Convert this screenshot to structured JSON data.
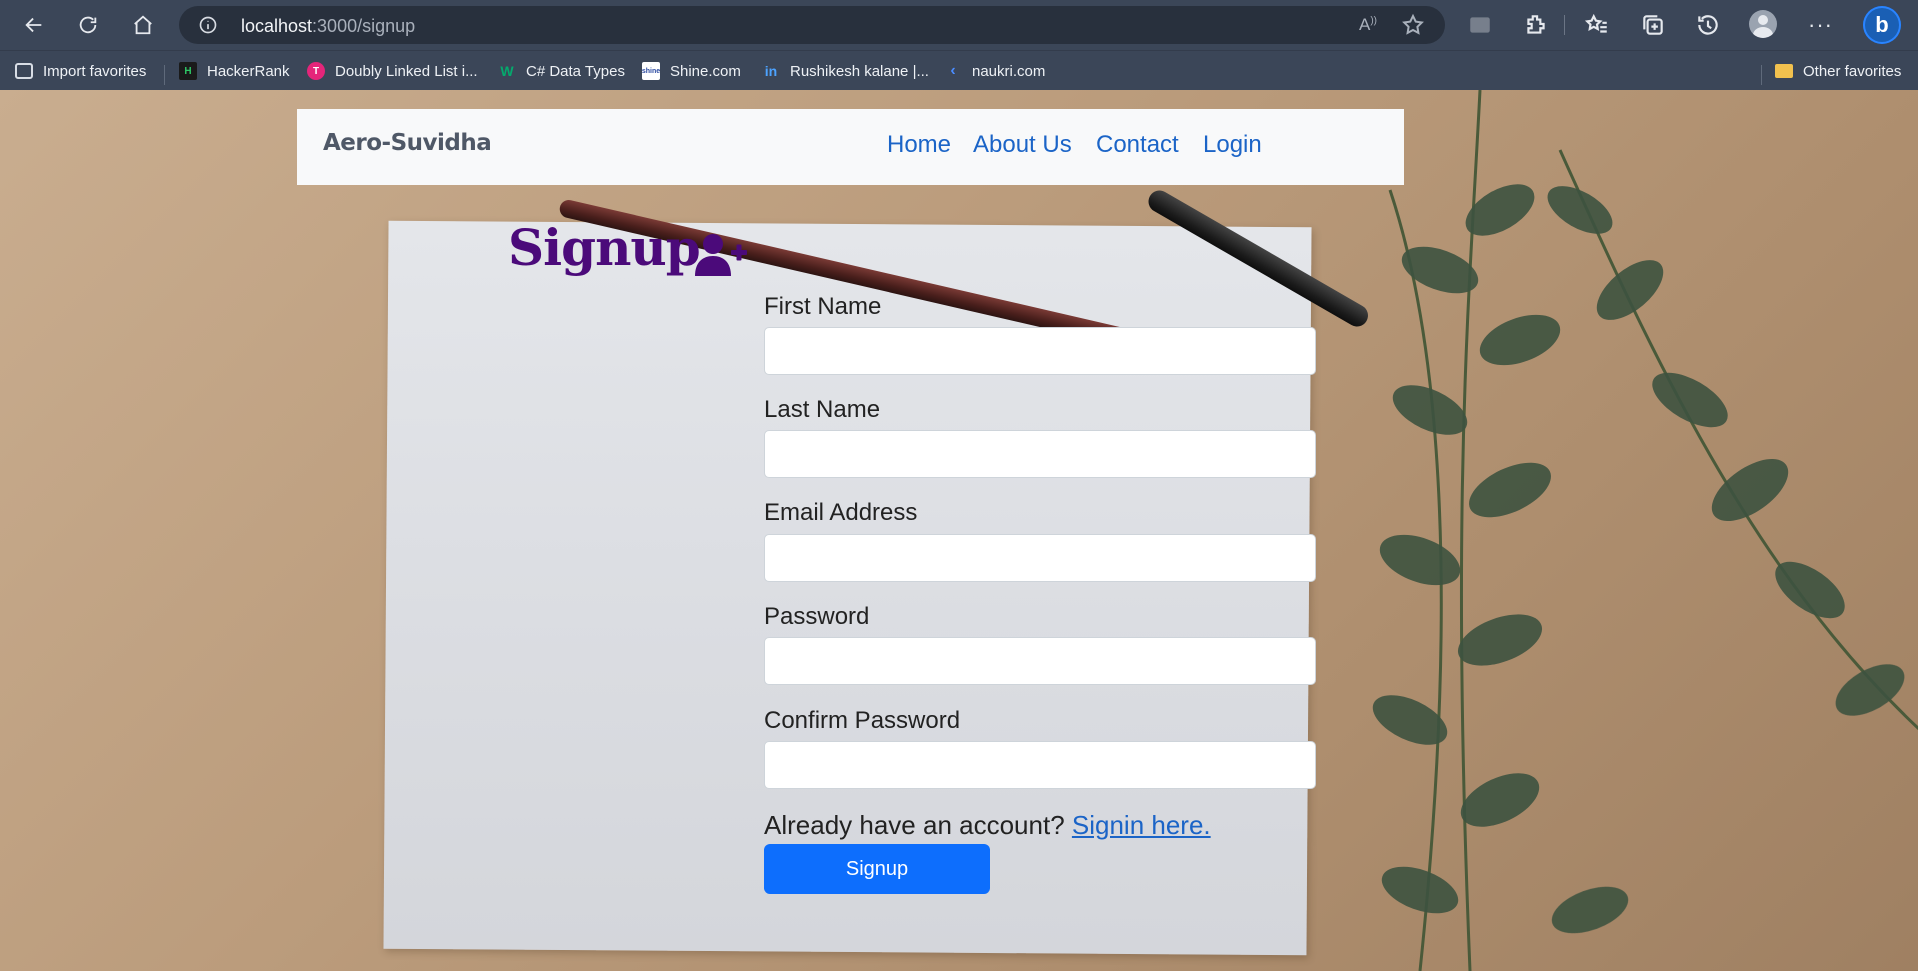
{
  "browser": {
    "url_host": "localhost",
    "url_path": ":3000/signup",
    "read_aloud_icon": "read-aloud-icon",
    "bookmarks": [
      {
        "label": "Import favorites",
        "icon": "import-icon"
      },
      {
        "label": "HackerRank",
        "icon": "hackerrank-icon"
      },
      {
        "label": "Doubly Linked List i...",
        "icon": "tutorial-icon"
      },
      {
        "label": "C# Data Types",
        "icon": "w3-icon"
      },
      {
        "label": "Shine.com",
        "icon": "shine-icon"
      },
      {
        "label": "Rushikesh kalane |...",
        "icon": "linkedin-icon"
      },
      {
        "label": "naukri.com",
        "icon": "naukri-icon"
      }
    ],
    "other_favorites": "Other favorites",
    "more_label": "···",
    "bing_label": "b"
  },
  "navbar": {
    "brand": "Aero-Suvidha",
    "links": [
      "Home",
      "About Us",
      "Contact",
      "Login"
    ]
  },
  "form": {
    "title": "Signup",
    "fields": [
      {
        "label": "First Name",
        "value": ""
      },
      {
        "label": "Last Name",
        "value": ""
      },
      {
        "label": "Email Address",
        "value": ""
      },
      {
        "label": "Password",
        "value": ""
      },
      {
        "label": "Confirm Password",
        "value": ""
      }
    ],
    "already_text": "Already have an account?",
    "signin_link": "Signin here.",
    "submit_label": "Signup"
  },
  "colors": {
    "title_purple": "#4b0a7a",
    "link_blue": "#1b64c7",
    "button_blue": "#0d6efd",
    "browser_chrome": "#3b4658"
  }
}
